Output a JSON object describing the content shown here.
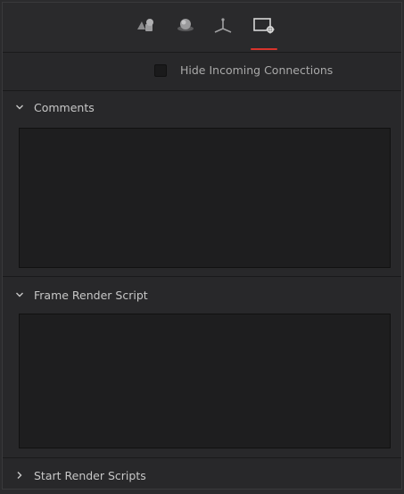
{
  "tabs": [
    {
      "name": "tools-tab",
      "icon": "shapes-icon",
      "active": false
    },
    {
      "name": "sphere-tab",
      "icon": "sphere-icon",
      "active": false
    },
    {
      "name": "transform-tab",
      "icon": "axis-icon",
      "active": false
    },
    {
      "name": "settings-tab",
      "icon": "settings-icon",
      "active": true
    }
  ],
  "hide_incoming": {
    "label": "Hide Incoming Connections",
    "checked": false
  },
  "sections": {
    "comments": {
      "title": "Comments",
      "expanded": true,
      "value": ""
    },
    "frame_render_script": {
      "title": "Frame Render Script",
      "expanded": true,
      "value": ""
    },
    "start_render_scripts": {
      "title": "Start Render Scripts",
      "expanded": false
    }
  },
  "colors": {
    "accent": "#d8342c",
    "background": "#28282a",
    "field": "#1e1e1f"
  }
}
